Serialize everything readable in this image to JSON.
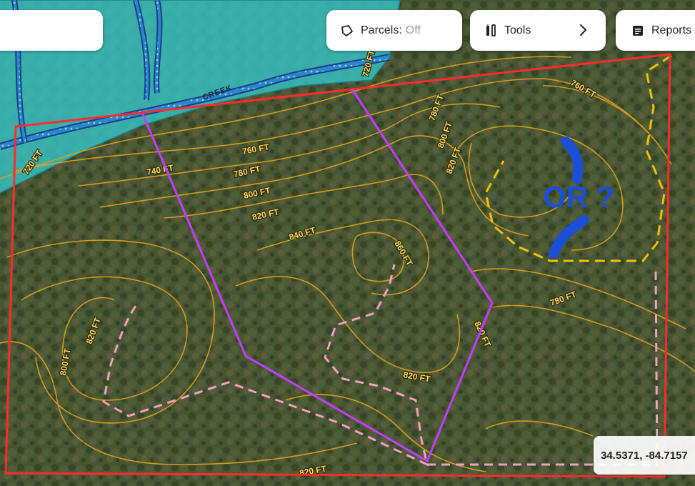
{
  "toolbar": {
    "parcels_label": "Parcels:",
    "parcels_value": "Off",
    "tools_label": "Tools",
    "reports_label": "Reports"
  },
  "map": {
    "creek_label": "CREEK",
    "contour_labels": {
      "c720_left": "720 FT",
      "c720_top": "720 FT",
      "c740": "740 FT",
      "c760_a": "760 FT",
      "c760_b": "760 FT",
      "c780_a": "780 FT",
      "c780_b": "780 FT",
      "c780_c": "780 FT",
      "c800_a": "800 FT",
      "c800_b": "800 FT",
      "c800_c": "800 FT",
      "c820_a": "820 FT",
      "c820_b": "820 FT",
      "c820_c": "820 FT",
      "c820_d": "820 FT",
      "c840": "840 FT",
      "c860": "860 FT",
      "c820_e": "820 FT",
      "c820_bottom": "820 FT"
    },
    "annotation_text": "OR ?",
    "coordinates": "34.5371, -84.7157",
    "colors": {
      "boundary": "#ff2a2a",
      "purple_line": "#c43cff",
      "pink_dash": "#f4a0c0",
      "yellow_dash": "#f2c200",
      "contour": "#e2a21a",
      "floodzone": "#36c2c4"
    }
  }
}
